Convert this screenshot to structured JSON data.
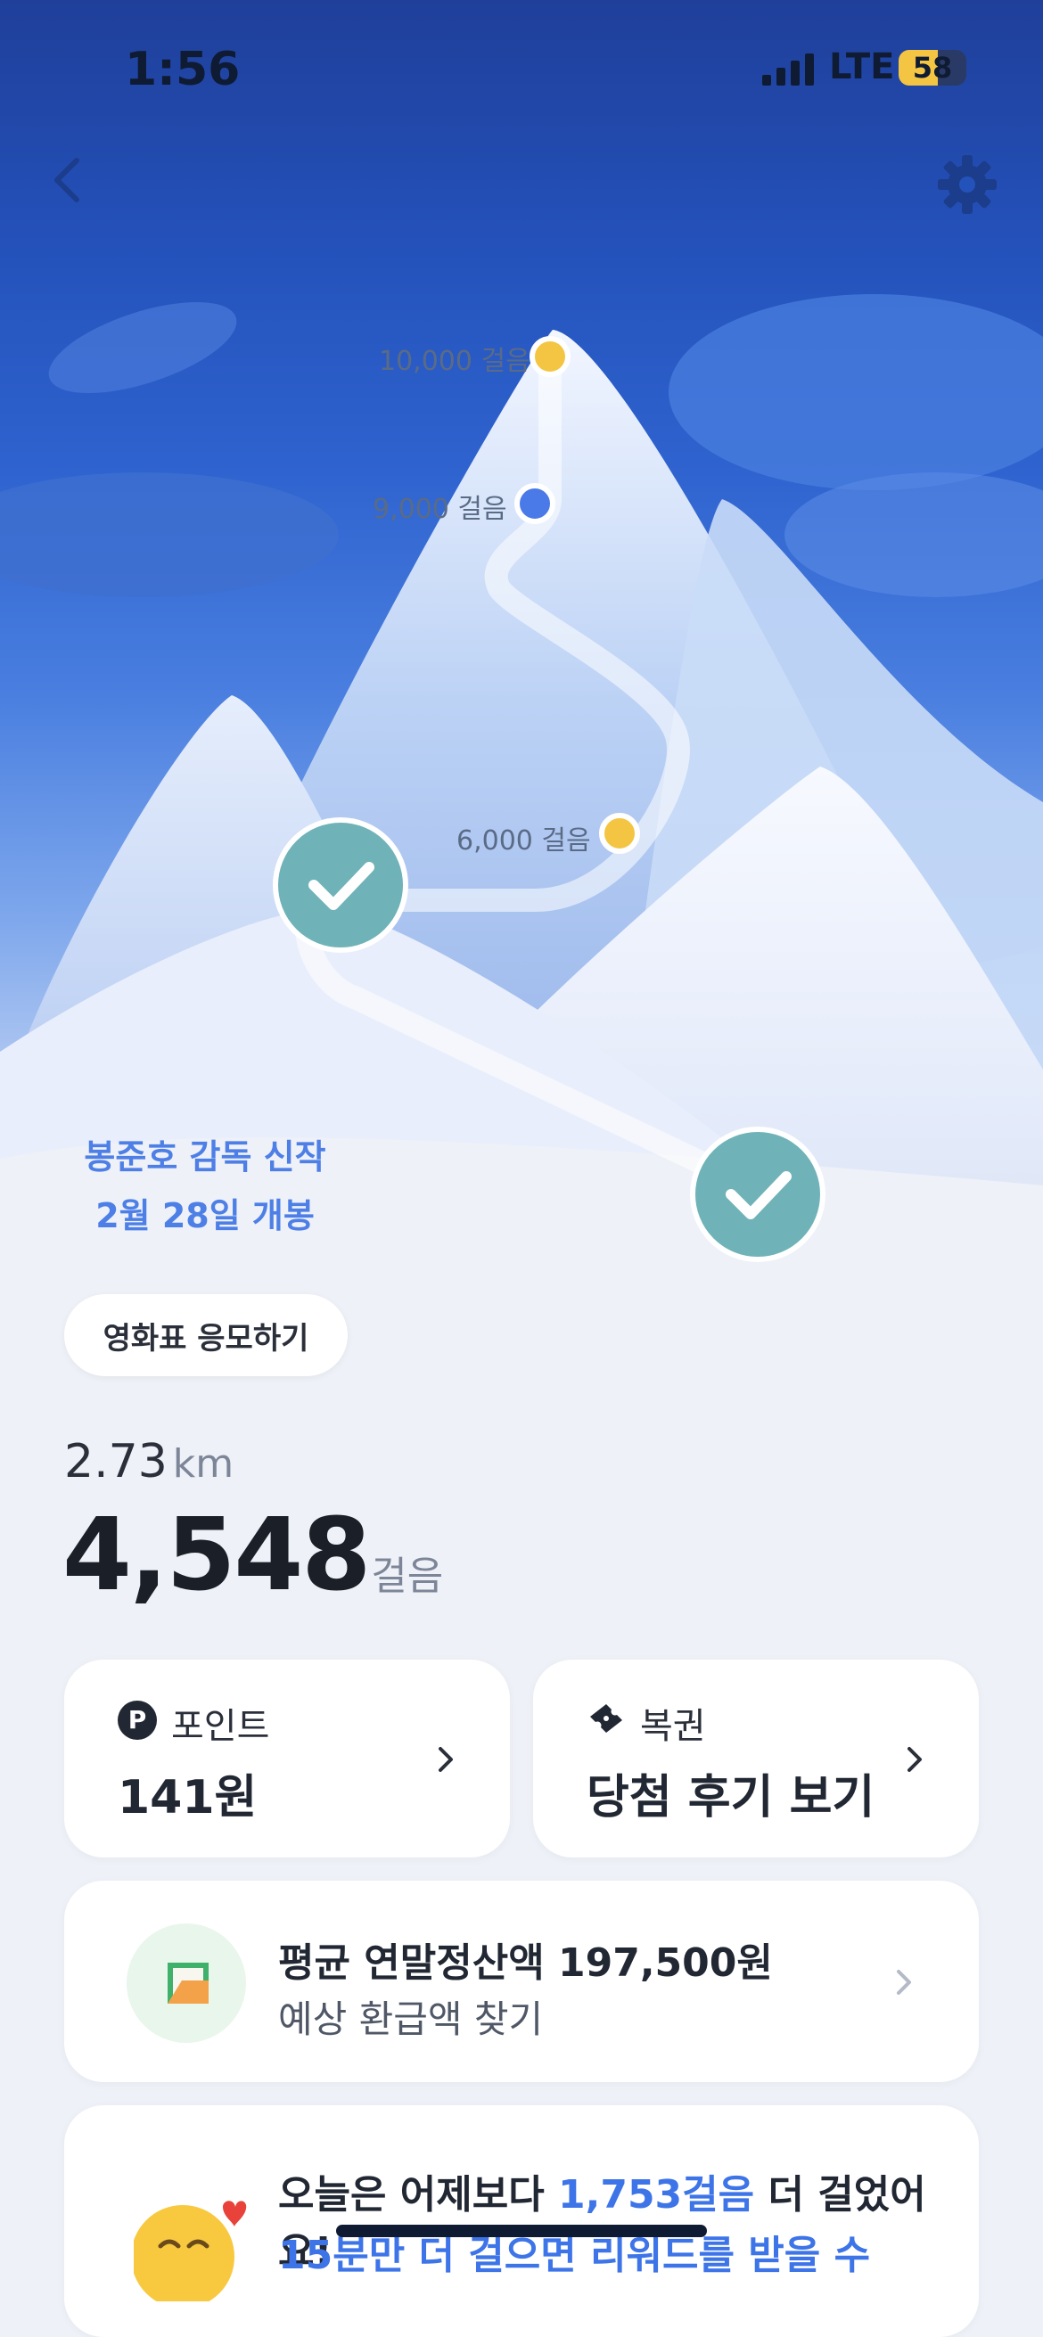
{
  "status_bar": {
    "time": "1:56",
    "network": "LTE",
    "battery": "58",
    "battery_level": 0.58
  },
  "milestones": [
    {
      "label": "10,000 걸음",
      "color": "#f4c542"
    },
    {
      "label": "9,000 걸음",
      "color": "#4a79e8"
    },
    {
      "label": "6,000 걸음",
      "color": "#f4c542"
    }
  ],
  "promo": {
    "line1": "봉준호 감독 신작",
    "line2": "2월 28일 개봉",
    "button": "영화표 응모하기"
  },
  "distance": {
    "value": "2.73",
    "unit": "km"
  },
  "steps": {
    "value": "4,548",
    "unit": "걸음"
  },
  "cards": {
    "points": {
      "label": "포인트",
      "value": "141원",
      "icon_text": "P"
    },
    "lottery": {
      "label": "복권",
      "value": "당첨 후기 보기"
    }
  },
  "tax": {
    "title": "평균 연말정산액 197,500원",
    "subtitle": "예상 환급액 찾기"
  },
  "compare": {
    "prefix": "오늘은 어제보다 ",
    "highlight": "1,753걸음",
    "suffix": " 더 걸었어요!",
    "line2": "15분만 더 걸으면 리워드를 받을 수"
  },
  "colors": {
    "accent": "#3d74e8",
    "milestone_yellow": "#f4c542",
    "check": "#6fb3b8"
  }
}
